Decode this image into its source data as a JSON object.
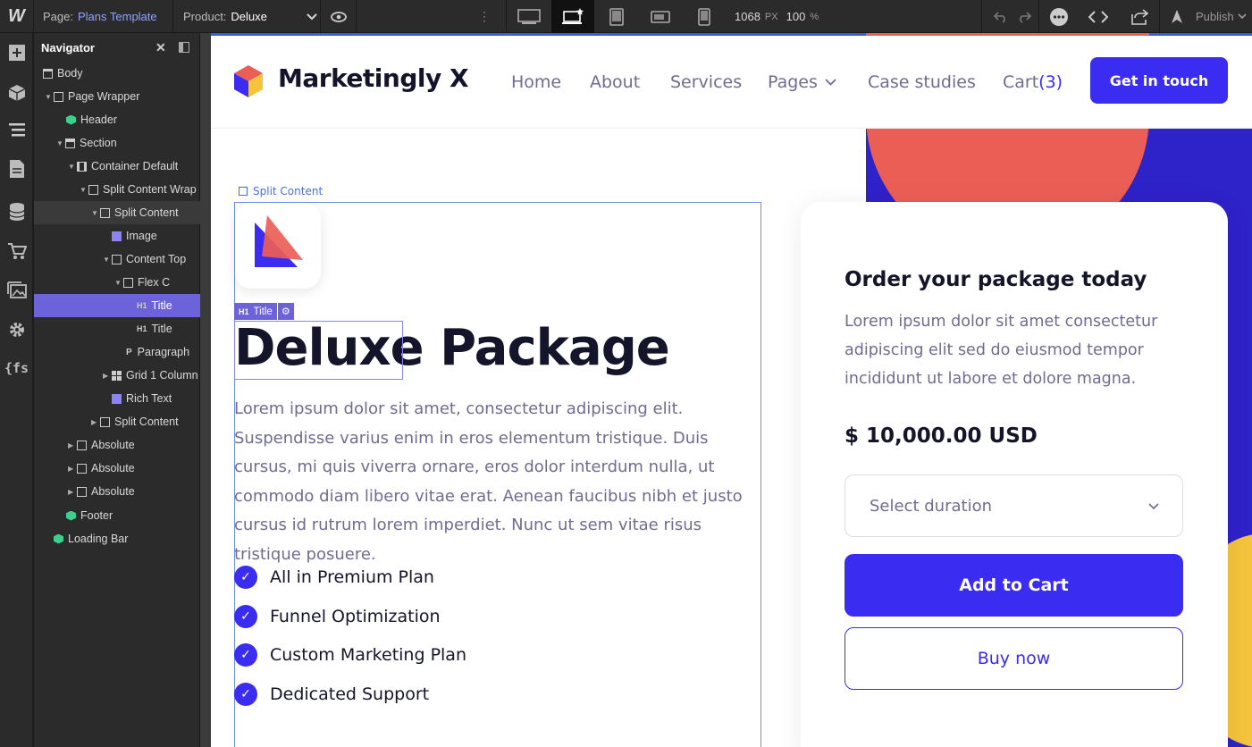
{
  "topbar": {
    "page_label": "Page:",
    "page_value": "Plans Template",
    "product_label": "Product:",
    "product_value": "Deluxe",
    "width_value": "1068",
    "width_unit": "PX",
    "zoom_value": "100",
    "zoom_unit": "%",
    "publish_label": "Publish"
  },
  "navigator": {
    "title": "Navigator",
    "items": [
      {
        "label": "Body"
      },
      {
        "label": "Page Wrapper"
      },
      {
        "label": "Header"
      },
      {
        "label": "Section"
      },
      {
        "label": "Container Default"
      },
      {
        "label": "Split Content Wrap"
      },
      {
        "label": "Split Content"
      },
      {
        "label": "Image"
      },
      {
        "label": "Content Top"
      },
      {
        "label": "Flex C"
      },
      {
        "label": "Title",
        "tag": "H1"
      },
      {
        "label": "Title",
        "tag": "H1"
      },
      {
        "label": "Paragraph",
        "tag": "P"
      },
      {
        "label": "Grid 1 Column"
      },
      {
        "label": "Rich Text"
      },
      {
        "label": "Split Content"
      },
      {
        "label": "Absolute"
      },
      {
        "label": "Absolute"
      },
      {
        "label": "Absolute"
      },
      {
        "label": "Footer"
      },
      {
        "label": "Loading Bar"
      }
    ]
  },
  "site": {
    "brand": "Marketingly X",
    "nav": {
      "home": "Home",
      "about": "About",
      "services": "Services",
      "pages": "Pages",
      "case_studies": "Case studies",
      "cart": "Cart",
      "cart_count": "(3)"
    },
    "cta": "Get in touch"
  },
  "selection": {
    "split_label": "Split Content",
    "h1_tag": "H1",
    "title_tag": "Title"
  },
  "product": {
    "title_word1": "Deluxe",
    "title_word2": "Package",
    "description": "Lorem ipsum dolor sit amet, consectetur adipiscing elit. Suspendisse varius enim in eros elementum tristique. Duis cursus, mi quis viverra ornare, eros dolor interdum nulla, ut commodo diam libero vitae erat. Aenean faucibus nibh et justo cursus id rutrum lorem imperdiet. Nunc ut sem vitae risus tristique posuere.",
    "features": [
      "All in Premium Plan",
      "Funnel Optimization",
      "Custom Marketing Plan",
      "Dedicated Support"
    ]
  },
  "order": {
    "title": "Order your package today",
    "description": "Lorem ipsum dolor sit amet consectetur adipiscing elit sed do eiusmod tempor incididunt ut labore et dolore magna.",
    "price": "$ 10,000.00 USD",
    "select_placeholder": "Select duration",
    "add_to_cart": "Add to Cart",
    "buy_now": "Buy now"
  },
  "colors": {
    "accent": "#3a2cf0",
    "coral": "#eb5e55",
    "yellow": "#f5c43c",
    "selection": "#6c62d9"
  }
}
